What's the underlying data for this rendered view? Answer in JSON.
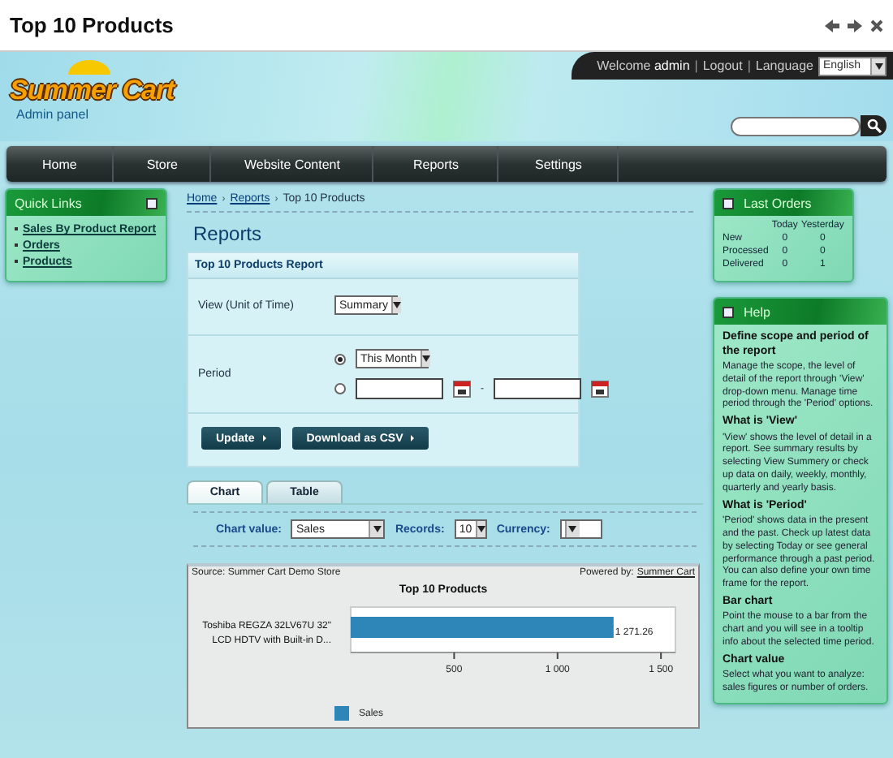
{
  "window": {
    "title": "Top 10 Products"
  },
  "header": {
    "logo": "Summer Cart",
    "subtitle": "Admin panel",
    "user_bar": [
      {
        "kind": "text",
        "label": "Welcome **admin**"
      },
      {
        "kind": "separator",
        "label": "|"
      },
      {
        "kind": "link",
        "label": "Logout"
      },
      {
        "kind": "separator",
        "label": "|"
      },
      {
        "kind": "text",
        "label": "Language"
      }
    ],
    "language": "English"
  },
  "nav": [
    "Home",
    "Store",
    "Website Content",
    "Reports",
    "Settings"
  ],
  "quick_links": {
    "title": "Quick Links",
    "items": [
      "Sales By Product Report",
      "Orders",
      "Products"
    ]
  },
  "breadcrumb": [
    {
      "kind": "link",
      "label": "Home"
    },
    {
      "kind": "separator",
      "label": "›"
    },
    {
      "kind": "link",
      "label": "Reports"
    },
    {
      "kind": "separator",
      "label": "›"
    },
    {
      "kind": "current",
      "label": "Top 10 Products"
    }
  ],
  "heading": "Reports",
  "report_form": {
    "title": "Top 10 Products Report",
    "view_label": "View (Unit of Time)",
    "view": "Summary",
    "period_label": "Period",
    "period_options": [
      {
        "kind": "preset",
        "selected": true,
        "value": "This Month"
      },
      {
        "kind": "range",
        "selected": false,
        "separator": "-"
      }
    ],
    "buttons": [
      "Update",
      "Download as CSV"
    ]
  },
  "tabs": [
    {
      "label": "Chart",
      "selected": true
    },
    {
      "label": "Table",
      "selected": false
    }
  ],
  "filters": [
    {
      "label": "Chart value:",
      "value": "Sales"
    },
    {
      "label": "Records:",
      "value": "10"
    },
    {
      "label": "Currency:"
    }
  ],
  "chart": {
    "source": "Source: Summer Cart Demo Store",
    "powered_label": "Powered by:",
    "powered_link": "Summer Cart",
    "chart_data": {
      "type": "bar",
      "orientation": "horizontal",
      "title": "Top 10 Products",
      "categories": [
        "Toshiba REGZA 32LV67U 32\" LCD HDTV with Built-in D..."
      ],
      "series": [
        {
          "name": "Sales",
          "color": "#2e86b8",
          "values": [
            1271
          ]
        }
      ],
      "xlim": [
        0,
        1570
      ],
      "xticks": [
        {
          "value": 500,
          "label": "500"
        },
        {
          "value": 1000,
          "label": "1 000"
        },
        {
          "value": 1500,
          "label": "1 500"
        }
      ],
      "value_labels": [
        "1 271.26"
      ]
    }
  },
  "last_orders": {
    "title": "Last Orders",
    "columns": [
      "Today",
      "Yesterday"
    ],
    "rows": [
      {
        "label": "New",
        "values": [
          "0",
          "0"
        ]
      },
      {
        "label": "Processed",
        "values": [
          "0",
          "0"
        ]
      },
      {
        "label": "Delivered",
        "values": [
          "0",
          "1"
        ]
      }
    ]
  },
  "help": {
    "title": "Help",
    "sections": [
      {
        "heading": "Define scope and period of the report",
        "text": "Manage the scope, the level of detail of the report through 'View' drop-down menu. Manage time period through the 'Period' options."
      },
      {
        "heading": "What is 'View'",
        "text": "'View' shows the level of detail in a report. See summary results by selecting View Summery or check up data on daily, weekly, monthly, quarterly and yearly basis."
      },
      {
        "heading": "What is 'Period'",
        "text": "'Period' shows data in the present and the past. Check up latest data by selecting Today or see general performance through a past period. You can also define your own time frame for the report."
      },
      {
        "heading": "Bar chart",
        "text": "Point the mouse to a bar from the chart and you will see in a tooltip info about the selected time period."
      },
      {
        "heading": "Chart value",
        "text": "Select what you want to analyze: sales figures or number of orders."
      }
    ]
  }
}
